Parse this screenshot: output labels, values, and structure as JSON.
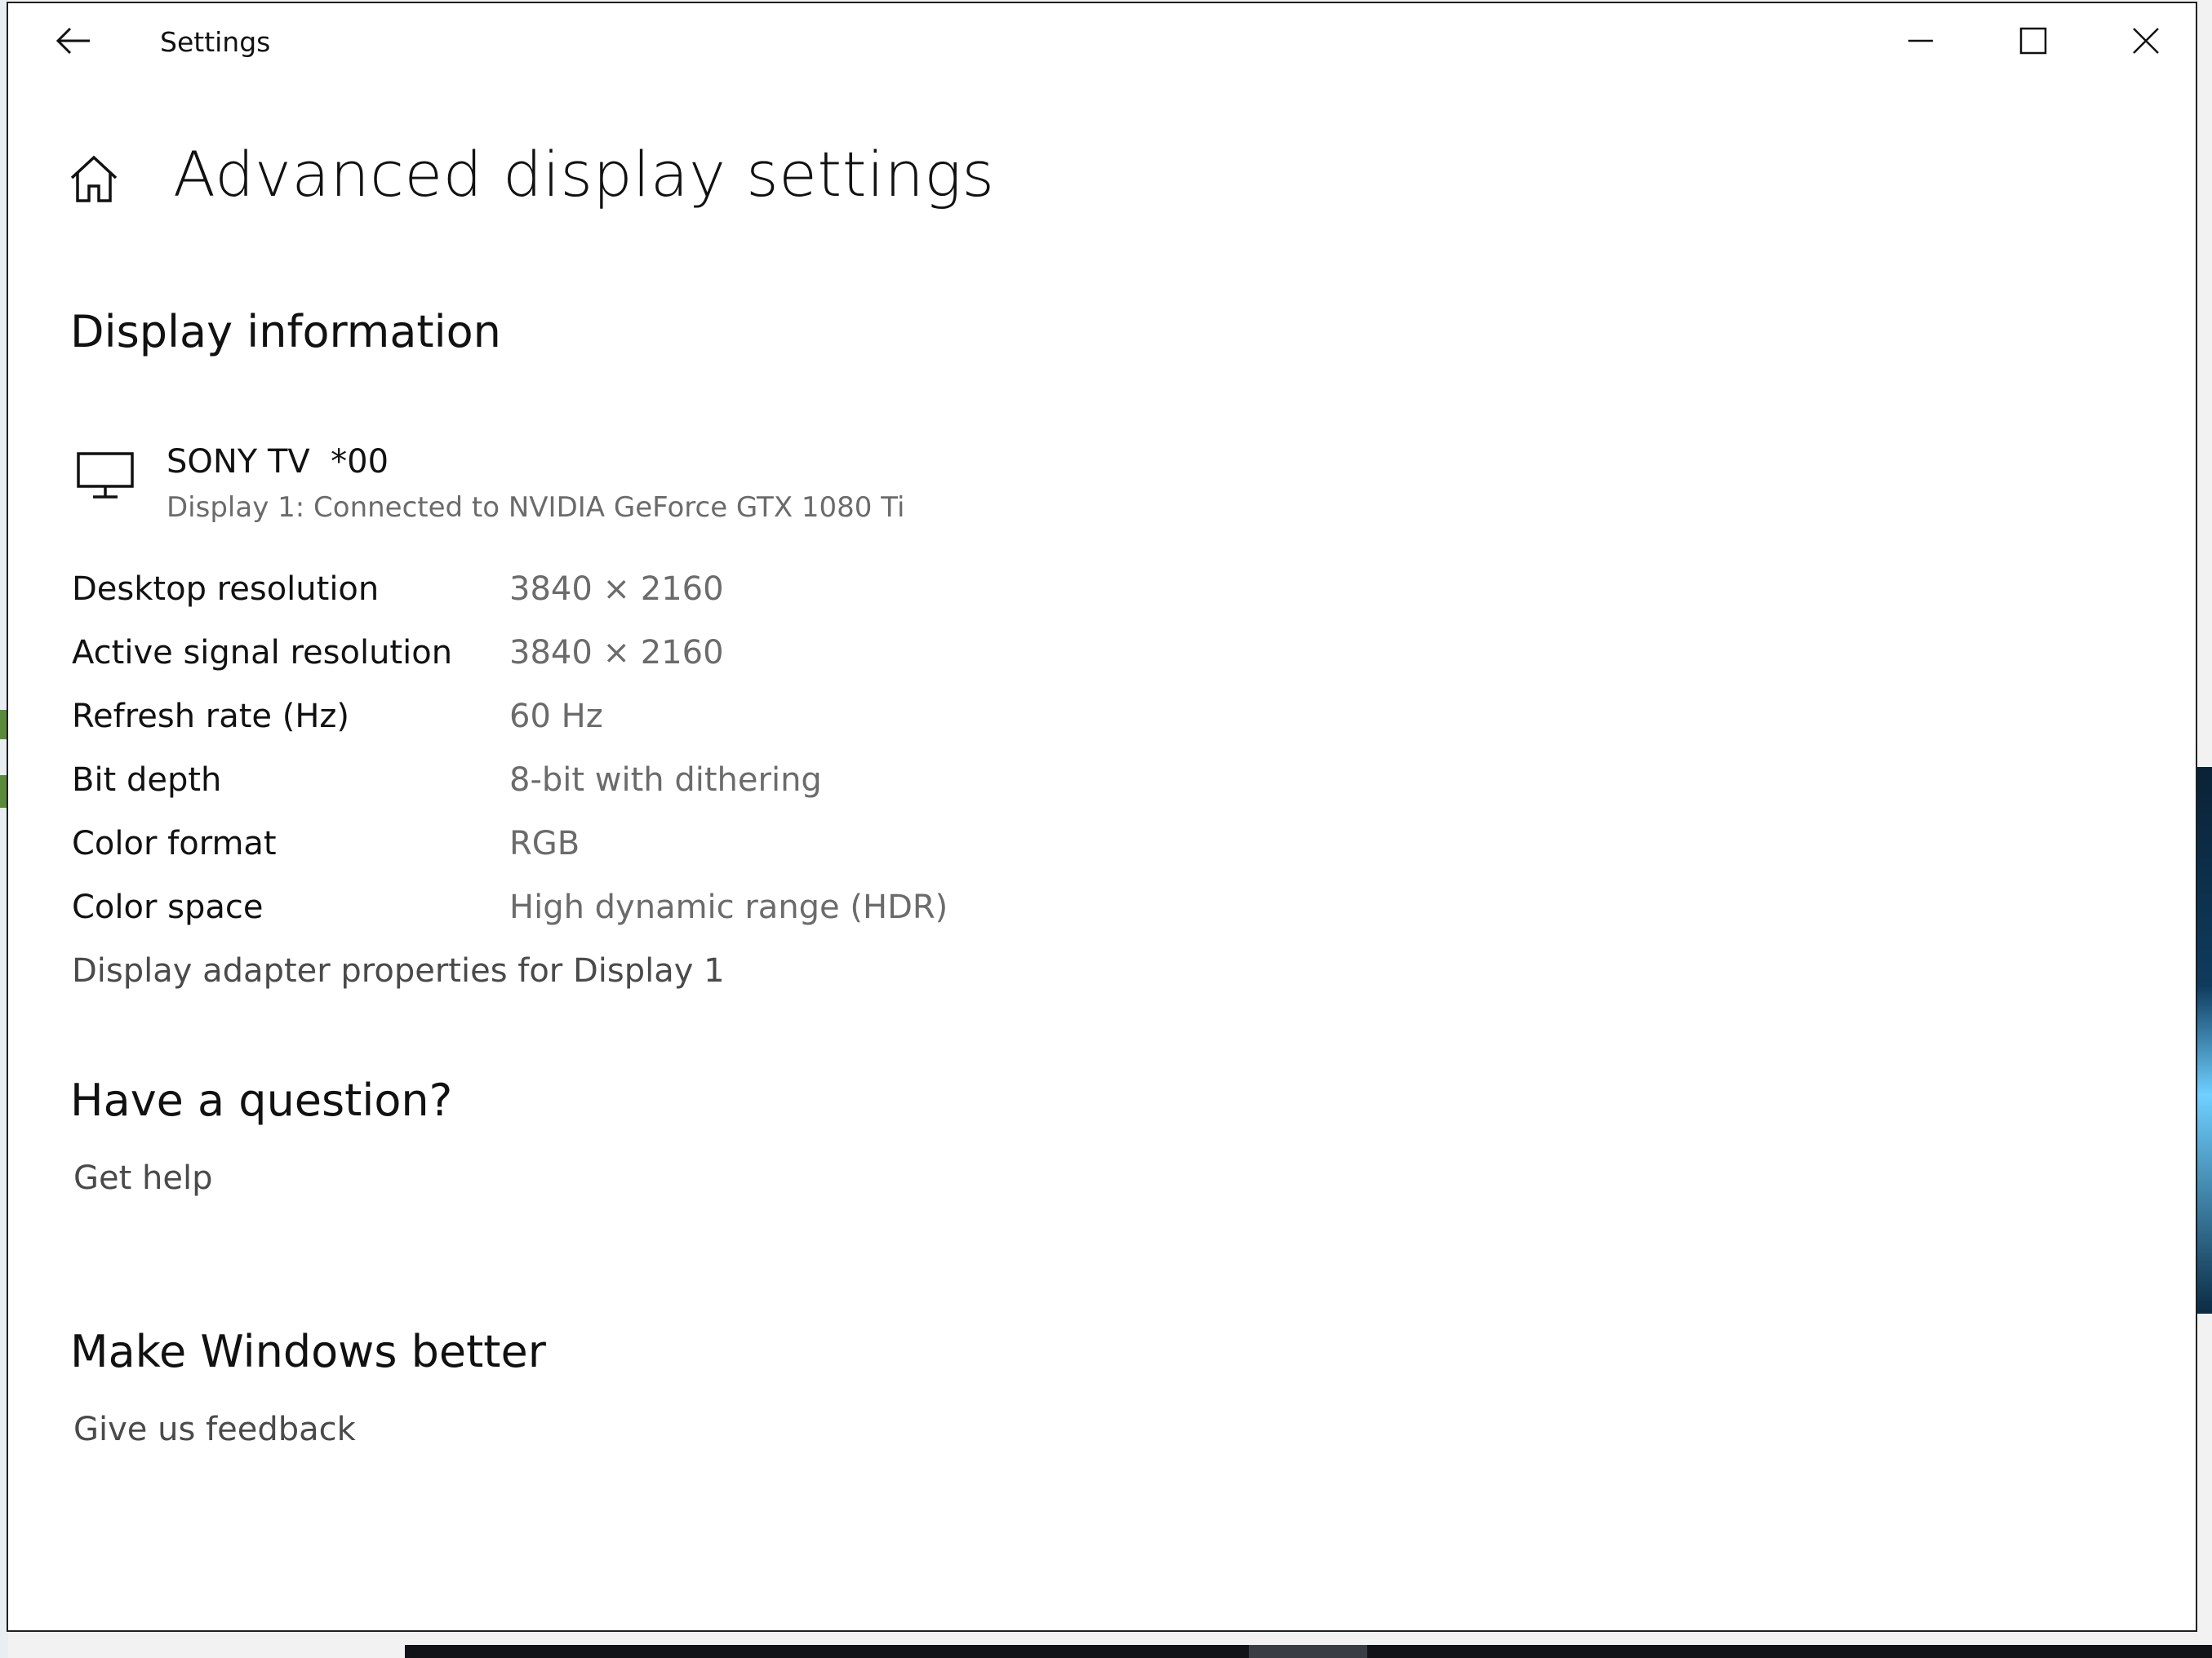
{
  "window": {
    "title": "Settings"
  },
  "page": {
    "title": "Advanced display settings"
  },
  "display_info": {
    "heading": "Display information",
    "display_name": "SONY TV  *00",
    "connection": "Display 1: Connected to NVIDIA GeForce GTX 1080 Ti",
    "rows": [
      {
        "label": "Desktop resolution",
        "value": "3840 × 2160"
      },
      {
        "label": "Active signal resolution",
        "value": "3840 × 2160"
      },
      {
        "label": "Refresh rate (Hz)",
        "value": "60 Hz"
      },
      {
        "label": "Bit depth",
        "value": "8-bit with dithering"
      },
      {
        "label": "Color format",
        "value": "RGB"
      },
      {
        "label": "Color space",
        "value": "High dynamic range (HDR)"
      }
    ],
    "adapter_link": "Display adapter properties for Display 1"
  },
  "question": {
    "heading": "Have a question?",
    "link": "Get help"
  },
  "feedback": {
    "heading": "Make Windows better",
    "link": "Give us feedback"
  },
  "icons": {
    "back": "back-arrow-icon",
    "home": "home-icon",
    "monitor": "monitor-icon",
    "minimize": "minimize-icon",
    "maximize": "maximize-icon",
    "close": "close-icon"
  }
}
